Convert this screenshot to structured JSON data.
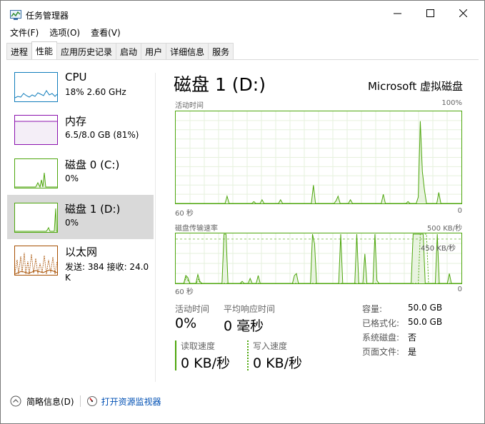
{
  "window": {
    "title": "任务管理器"
  },
  "menu": [
    "文件(F)",
    "选项(O)",
    "查看(V)"
  ],
  "tabs": [
    "进程",
    "性能",
    "应用历史记录",
    "启动",
    "用户",
    "详细信息",
    "服务"
  ],
  "sidebar": {
    "items": [
      {
        "title": "CPU",
        "subtitle": "18%  2.60 GHz"
      },
      {
        "title": "内存",
        "subtitle": "6.5/8.0 GB (81%)"
      },
      {
        "title": "磁盘 0 (C:)",
        "subtitle": "0%"
      },
      {
        "title": "磁盘 1 (D:)",
        "subtitle": "0%"
      },
      {
        "title": "以太网",
        "subtitle": "发送: 384  接收: 24.0 K"
      }
    ]
  },
  "main": {
    "title": "磁盘 1 (D:)",
    "model": "Microsoft 虚拟磁盘",
    "graph1": {
      "label_left": "活动时间",
      "label_right": "100%",
      "axis_left": "60 秒",
      "axis_right": "0",
      "active_pct": [
        0,
        0,
        0,
        0,
        0,
        0,
        0,
        0,
        0,
        0,
        0,
        0,
        0,
        0,
        0,
        0,
        0,
        0,
        0,
        0,
        0,
        0,
        0,
        0,
        0,
        8,
        0,
        0,
        0,
        0,
        0,
        0,
        0,
        0,
        0,
        0,
        0,
        0,
        2,
        0,
        0,
        0,
        4,
        0,
        0,
        0,
        0,
        0,
        0,
        0,
        0,
        4,
        0,
        0,
        0,
        0,
        0,
        0,
        0,
        0,
        0,
        0,
        0,
        0,
        0,
        0,
        0,
        20,
        0,
        0,
        0,
        0,
        0,
        0,
        0,
        0,
        0,
        0,
        3,
        8,
        0,
        0,
        0,
        0,
        0,
        4,
        0,
        0,
        0,
        0,
        0,
        0,
        0,
        0,
        0,
        0,
        0,
        0,
        0,
        0,
        0,
        10,
        0,
        0,
        0,
        0,
        0,
        0,
        0,
        0,
        0,
        0,
        0,
        2,
        0,
        0,
        0,
        0,
        7,
        90,
        35,
        15,
        0,
        0,
        0,
        0,
        0,
        0,
        12,
        0,
        0,
        0,
        0,
        0,
        0,
        0,
        0,
        0,
        0,
        0
      ]
    },
    "graph2": {
      "label_left": "磁盘传输速率",
      "label_right": "500 KB/秒",
      "annotation": "450 KB/秒",
      "axis_left": "60 秒",
      "axis_right": "0",
      "read_kbps": [
        0,
        0,
        0,
        0,
        0,
        60,
        30,
        0,
        0,
        0,
        0,
        40,
        0,
        0,
        0,
        0,
        0,
        0,
        0,
        0,
        0,
        0,
        0,
        0,
        0,
        0,
        0,
        0,
        0,
        0,
        0,
        0,
        0,
        0,
        0,
        0,
        0,
        0,
        0,
        0,
        0,
        0,
        0,
        0,
        0,
        0,
        0,
        0,
        0,
        0,
        0,
        0,
        0,
        0,
        0,
        0,
        0,
        0,
        0,
        0,
        0,
        0,
        0,
        0,
        0,
        0,
        0,
        0,
        0,
        0,
        0,
        0,
        0,
        0,
        0,
        0,
        0,
        0,
        0,
        0,
        0,
        0,
        0,
        0,
        0,
        0,
        0,
        0,
        0,
        0,
        0,
        0,
        0,
        0,
        0,
        0,
        0,
        0,
        0,
        0,
        0,
        0,
        0,
        0,
        0,
        0,
        0,
        0,
        0,
        0,
        0,
        0,
        0,
        0,
        0,
        0,
        0,
        0,
        0,
        500,
        500,
        500,
        500,
        0,
        0,
        0,
        0,
        0,
        0,
        0,
        0,
        0,
        0,
        0,
        0,
        0,
        0,
        0,
        0,
        0
      ],
      "write_kbps": [
        0,
        0,
        0,
        0,
        0,
        80,
        60,
        0,
        0,
        0,
        0,
        90,
        20,
        0,
        0,
        0,
        0,
        0,
        0,
        0,
        0,
        0,
        0,
        0,
        500,
        500,
        0,
        0,
        0,
        0,
        0,
        0,
        0,
        20,
        0,
        0,
        0,
        50,
        0,
        0,
        0,
        80,
        0,
        0,
        0,
        0,
        0,
        0,
        0,
        0,
        0,
        0,
        0,
        0,
        0,
        0,
        0,
        0,
        0,
        80,
        100,
        0,
        0,
        0,
        0,
        0,
        0,
        0,
        500,
        400,
        0,
        0,
        0,
        0,
        0,
        0,
        0,
        0,
        0,
        0,
        0,
        0,
        500,
        0,
        0,
        0,
        0,
        0,
        0,
        0,
        500,
        0,
        0,
        0,
        300,
        0,
        0,
        0,
        0,
        500,
        30,
        0,
        0,
        0,
        0,
        0,
        0,
        0,
        0,
        0,
        0,
        0,
        0,
        0,
        0,
        0,
        0,
        0,
        500,
        500,
        500,
        500,
        500,
        500,
        0,
        0,
        0,
        0,
        0,
        0,
        500,
        0,
        0,
        0,
        0,
        0,
        100,
        0,
        0,
        0,
        0,
        0,
        0
      ]
    },
    "stats": {
      "active_label": "活动时间",
      "active_value": "0%",
      "resp_label": "平均响应时间",
      "resp_value": "0 毫秒",
      "read_label": "读取速度",
      "read_value": "0 KB/秒",
      "write_label": "写入速度",
      "write_value": "0 KB/秒"
    },
    "props": [
      {
        "k": "容量:",
        "v": "50.0 GB"
      },
      {
        "k": "已格式化:",
        "v": "50.0 GB"
      },
      {
        "k": "系统磁盘:",
        "v": "否"
      },
      {
        "k": "页面文件:",
        "v": "是"
      }
    ]
  },
  "footer": {
    "summary": "简略信息(D)",
    "monitor": "打开资源监视器"
  },
  "colors": {
    "disk": "#4da60c",
    "cpu": "#117dbb",
    "mem": "#8b12ae",
    "net": "#a74f01"
  }
}
